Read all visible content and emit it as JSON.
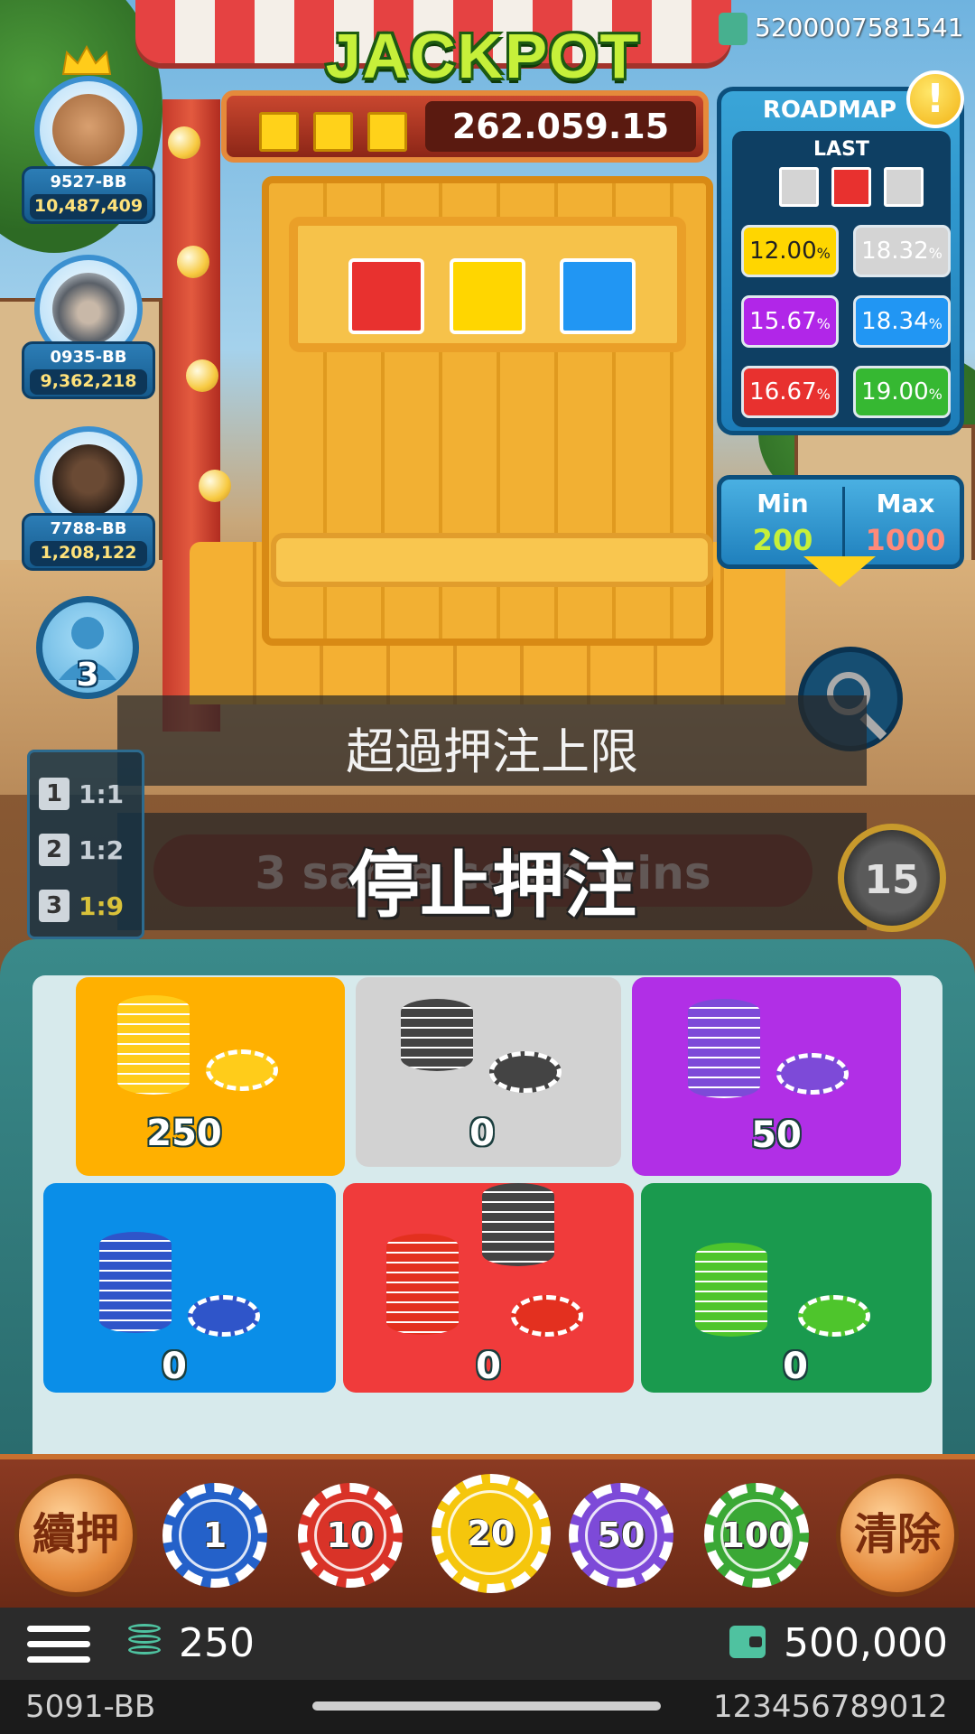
{
  "jackpot": {
    "title": "JACKPOT",
    "value": "262.059.15",
    "slot_color": "#ffd21a"
  },
  "top_bar": {
    "account_id": "5200007581541"
  },
  "players": [
    {
      "name": "9527-BB",
      "score": "10,487,409",
      "avatar": "teddy-bear-avatar",
      "crown": true
    },
    {
      "name": "0935-BB",
      "score": "9,362,218",
      "avatar": "hooded-assassin-avatar",
      "crown": false
    },
    {
      "name": "7788-BB",
      "score": "1,208,122",
      "avatar": "dark-bear-avatar",
      "crown": false
    }
  ],
  "other_players": {
    "count": "3"
  },
  "crate": {
    "colors": [
      "#e8312f",
      "#ffd600",
      "#2196f3"
    ]
  },
  "roadmap": {
    "title": "ROADMAP",
    "alert": "!",
    "last_label": "LAST",
    "last_results": [
      "#d4d4d4",
      "#e8312f",
      "#d4d4d4"
    ],
    "percentages": [
      {
        "value": "12.00",
        "unit": "%",
        "color": "#ffd600",
        "text_color": "#222",
        "frozen": true
      },
      {
        "value": "18.32",
        "unit": "%",
        "color": "#d4d4d4",
        "text_color": "#fff"
      },
      {
        "value": "15.67",
        "unit": "%",
        "color": "#b126e8",
        "text_color": "#fff"
      },
      {
        "value": "18.34",
        "unit": "%",
        "color": "#2196f3",
        "text_color": "#fff"
      },
      {
        "value": "16.67",
        "unit": "%",
        "color": "#e8312f",
        "text_color": "#fff"
      },
      {
        "value": "19.00",
        "unit": "%",
        "color": "#36b832",
        "text_color": "#fff",
        "hot": true
      }
    ]
  },
  "limits": {
    "min_label": "Min",
    "min_value": "200",
    "max_label": "Max",
    "max_value": "1000"
  },
  "messages": {
    "over_limit": "超過押注上限",
    "stop_betting": "停止押注",
    "hint": "3 same color wins"
  },
  "odds": [
    {
      "num": "1",
      "ratio": "1:1",
      "color": "#c7cfd6"
    },
    {
      "num": "2",
      "ratio": "1:2",
      "color": "#c7cfd6"
    },
    {
      "num": "3",
      "ratio": "1:9",
      "color": "#d9c23a"
    }
  ],
  "timer": {
    "seconds": "15"
  },
  "bets": [
    {
      "color": "#ffb000",
      "chip_color": "#ffcc1a",
      "amount": "250"
    },
    {
      "color": "#d2d2d2",
      "chip_color": "#444444",
      "amount": "0"
    },
    {
      "color": "#b12fe6",
      "chip_color": "#7d4ad8",
      "amount": "50"
    },
    {
      "color": "#0a8ee8",
      "chip_color": "#2f55c9",
      "amount": "0"
    },
    {
      "color": "#f03b3b",
      "chip_color": "#e3301f",
      "amount": "0"
    },
    {
      "color": "#1a9a4e",
      "chip_color": "#4ec52c",
      "amount": "0"
    }
  ],
  "chip_bar": {
    "rebet_label": "續押",
    "clear_label": "清除",
    "chips": [
      {
        "value": "1",
        "color": "#2461c9"
      },
      {
        "value": "10",
        "color": "#d93328"
      },
      {
        "value": "20",
        "color": "#f5c60c"
      },
      {
        "value": "50",
        "color": "#7d4ad8"
      },
      {
        "value": "100",
        "color": "#3aa835"
      }
    ]
  },
  "status": {
    "total_bet": "250",
    "balance": "500,000"
  },
  "footer": {
    "user": "5091-BB",
    "number": "123456789012"
  }
}
